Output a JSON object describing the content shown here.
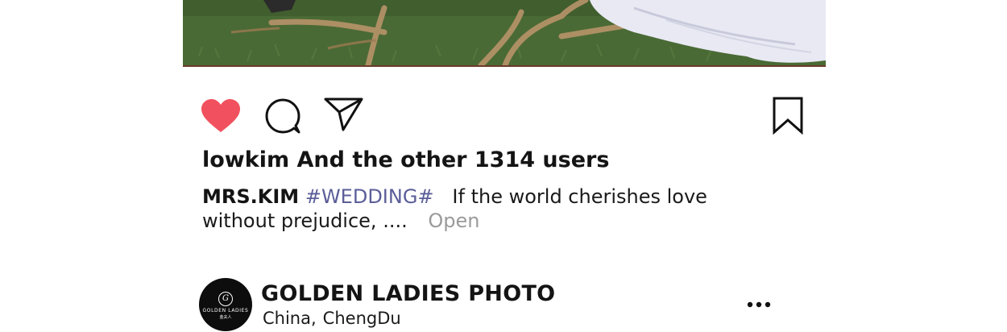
{
  "post": {
    "image": {
      "description_icon": "wedding-dress-on-grass-photo"
    },
    "actions": {
      "like_icon": "heart-filled-icon",
      "like_color": "#f1515e",
      "comment_icon": "comment-bubble-icon",
      "share_icon": "send-paper-plane-icon",
      "save_icon": "bookmark-icon"
    },
    "likes_text": "lowkim And the other 1314 users",
    "caption": {
      "author": "MRS.KIM",
      "hashtag": "#WEDDING#",
      "text": "If the world cherishes love without prejudice, ....",
      "open_label": "Open",
      "hashtag_color": "#5b5e98"
    }
  },
  "account": {
    "name": "GOLDEN LADIES PHOTO",
    "location_country": "China,",
    "location_city": "ChengDu",
    "avatar": {
      "monogram": "G",
      "brand_text": "GOLDEN LADIES",
      "brand_sub": "金夫人"
    },
    "more_icon": "more-dots-icon"
  }
}
